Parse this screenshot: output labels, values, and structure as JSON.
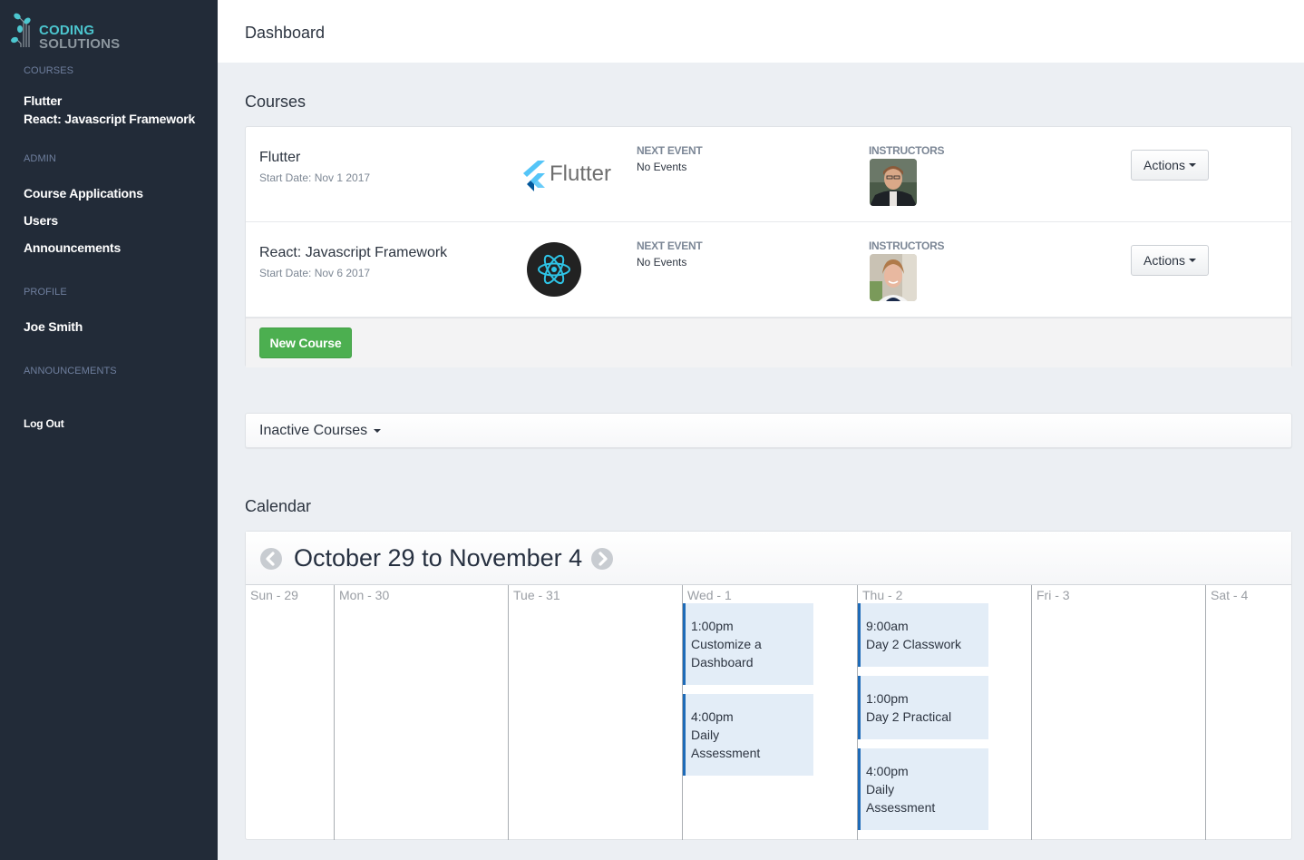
{
  "brand": {
    "line1": "CODING",
    "line2": "SOLUTIONS",
    "accent": "#4cc6cf"
  },
  "sidebar": {
    "sections": [
      {
        "heading": "COURSES",
        "items": [
          "Flutter",
          "React: Javascript Framework"
        ]
      },
      {
        "heading": "ADMIN",
        "items": [
          "Course Applications",
          "Users",
          "Announcements"
        ]
      },
      {
        "heading": "PROFILE",
        "items": [
          "Joe Smith"
        ]
      },
      {
        "heading": "ANNOUNCEMENTS",
        "items": []
      }
    ],
    "logout": "Log Out"
  },
  "header": {
    "title": "Dashboard"
  },
  "courses": {
    "title": "Courses",
    "next_event_label": "NEXT EVENT",
    "instructors_label": "INSTRUCTORS",
    "actions_label": "Actions",
    "new_course_label": "New Course",
    "items": [
      {
        "name": "Flutter",
        "start_date": "Start Date: Nov 1 2017",
        "logo_text": "Flutter",
        "logo_icon": "flutter-logo",
        "next_event": "No Events",
        "instructor_avatar": "male-instructor-photo"
      },
      {
        "name": "React: Javascript Framework",
        "start_date": "Start Date: Nov 6 2017",
        "logo_icon": "react-logo",
        "next_event": "No Events",
        "instructor_avatar": "female-instructor-photo"
      }
    ]
  },
  "inactive": {
    "label": "Inactive Courses"
  },
  "calendar": {
    "title": "Calendar",
    "range": "October 29 to November 4",
    "prev_icon": "chevron-left-circle-icon",
    "next_icon": "chevron-right-circle-icon",
    "days": [
      {
        "label": "Sun - 29",
        "events": []
      },
      {
        "label": "Mon - 30",
        "events": []
      },
      {
        "label": "Tue - 31",
        "events": []
      },
      {
        "label": "Wed - 1",
        "events": [
          {
            "time": "1:00pm",
            "title": "Customize a Dashboard"
          },
          {
            "time": "4:00pm",
            "title": "Daily Assessment"
          }
        ]
      },
      {
        "label": "Thu - 2",
        "events": [
          {
            "time": "9:00am",
            "title": "Day 2 Classwork"
          },
          {
            "time": "1:00pm",
            "title": "Day 2 Practical"
          },
          {
            "time": "4:00pm",
            "title": "Daily Assessment"
          }
        ]
      },
      {
        "label": "Fri - 3",
        "events": []
      },
      {
        "label": "Sat - 4",
        "events": []
      }
    ]
  }
}
